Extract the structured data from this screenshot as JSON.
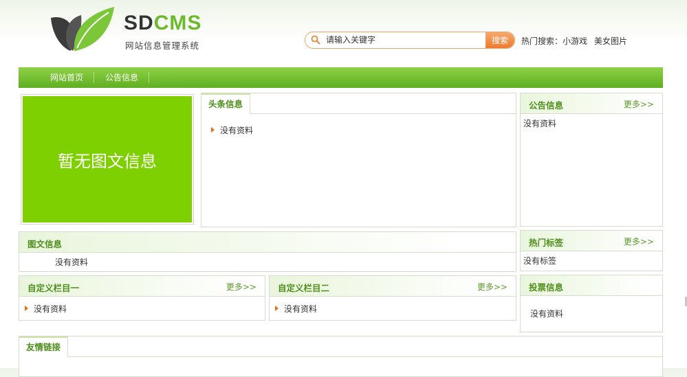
{
  "logo": {
    "brand_a": "SD",
    "brand_b": "CMS",
    "subtitle": "网站信息管理系统"
  },
  "search": {
    "placeholder": "请输入关键字",
    "button": "搜索"
  },
  "hot_search": {
    "label": "热门搜索：",
    "items": [
      "小游戏",
      "美女图片"
    ]
  },
  "nav": [
    "网站首页",
    "公告信息"
  ],
  "pic": {
    "empty": "暂无图文信息"
  },
  "headline": {
    "title": "头条信息",
    "item": "没有资料"
  },
  "notice": {
    "title": "公告信息",
    "more": "更多>>",
    "empty": "没有资料"
  },
  "gallery": {
    "title": "图文信息",
    "empty": "没有资料"
  },
  "tags": {
    "title": "热门标签",
    "more": "更多>>",
    "empty": "没有标签"
  },
  "custom1": {
    "title": "自定义栏目一",
    "more": "更多>>",
    "item": "没有资料"
  },
  "custom2": {
    "title": "自定义栏目二",
    "more": "更多>>",
    "item": "没有资料"
  },
  "vote": {
    "title": "投票信息",
    "empty": "没有资料"
  },
  "links": {
    "title": "友情链接"
  },
  "colors": {
    "brand_green": "#6cba2c",
    "nav_green": "#5fae21",
    "search_orange": "#ef7a2c",
    "placeholder_green": "#7fd000"
  }
}
